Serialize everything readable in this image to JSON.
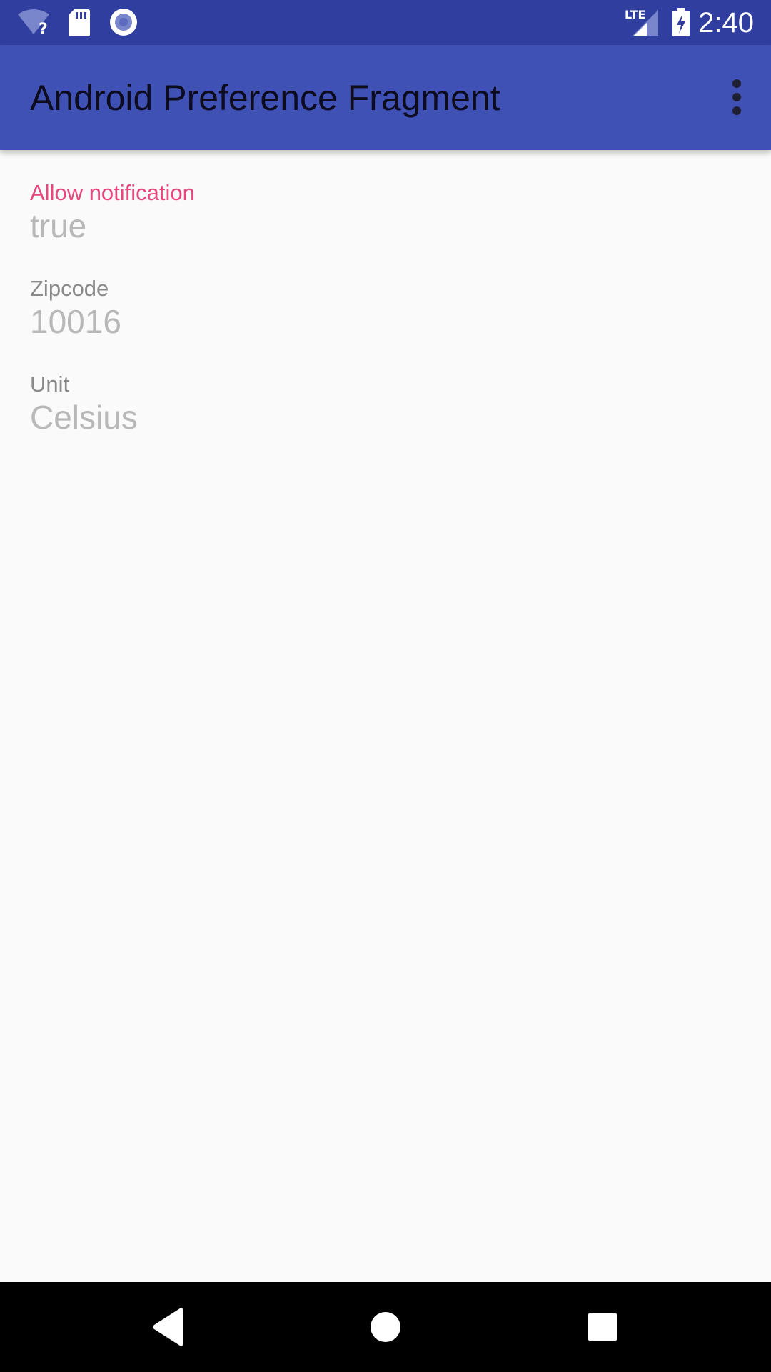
{
  "status_bar": {
    "time": "2:40",
    "network_label": "LTE",
    "icons": [
      "wifi-unknown-icon",
      "sd-card-icon",
      "sync-circle-icon",
      "lte-signal-icon",
      "battery-charging-icon"
    ]
  },
  "app_bar": {
    "title": "Android Preference Fragment",
    "overflow_icon": "more-vert-icon"
  },
  "preferences": [
    {
      "title": "Allow notification",
      "summary": "true"
    },
    {
      "title": "Zipcode",
      "summary": "10016"
    },
    {
      "title": "Unit",
      "summary": "Celsius"
    }
  ],
  "nav_bar": {
    "icons": [
      "back-icon",
      "home-icon",
      "recents-icon"
    ]
  },
  "colors": {
    "status_bar": "#303f9f",
    "app_bar": "#3f51b5",
    "accent": "#e8467c",
    "background": "#fafafa"
  }
}
